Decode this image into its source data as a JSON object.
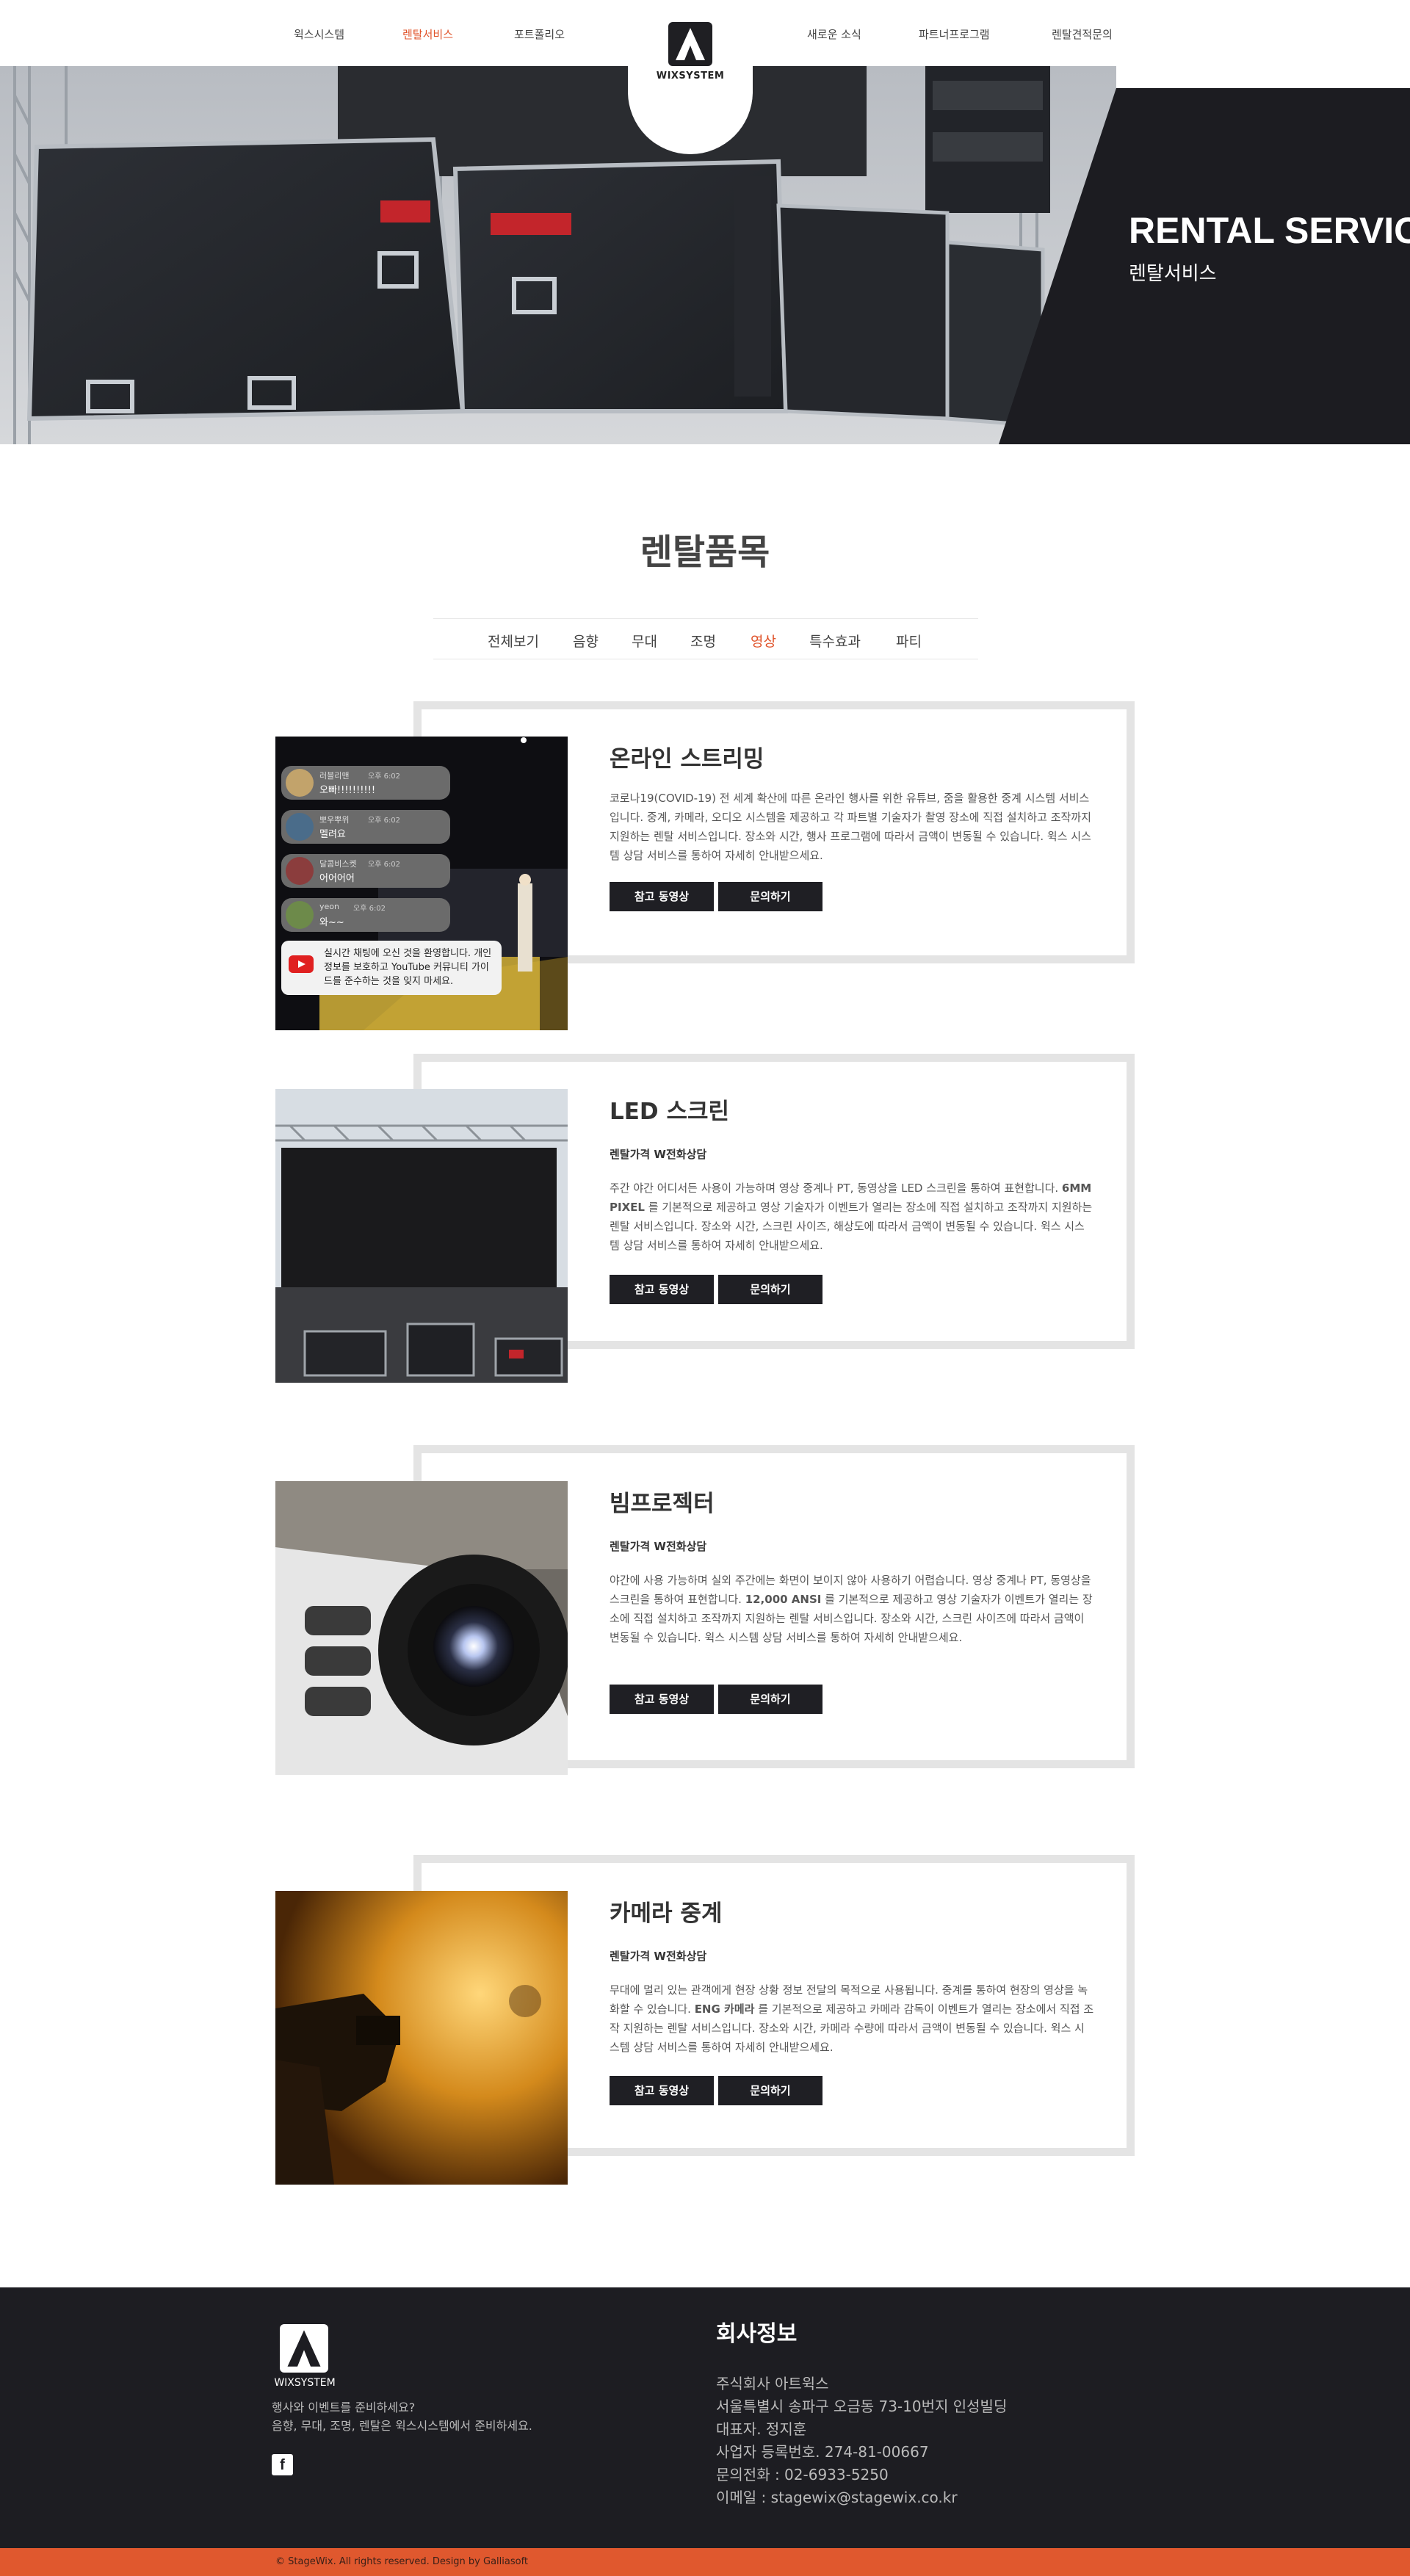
{
  "nav": {
    "items": [
      "윅스시스템",
      "렌탈서비스",
      "포트폴리오",
      "새로운 소식",
      "파트너프로그램",
      "렌탈견적문의"
    ],
    "active": "렌탈서비스",
    "logo_text": "WIXSYSTEM"
  },
  "hero": {
    "title": "RENTAL SERVICE",
    "subtitle": "렌탈서비스"
  },
  "section": {
    "title": "렌탈품목",
    "filters": [
      "전체보기",
      "음향",
      "무대",
      "조명",
      "영상",
      "특수효과",
      "파티"
    ],
    "active_filter": "영상"
  },
  "streaming_overlay": {
    "comments": [
      {
        "user": "러블리맨",
        "time": "오후 6:02",
        "text": "오빠!!!!!!!!!!"
      },
      {
        "user": "뽀우뿌위",
        "time": "오후 6:02",
        "text": "멜려요"
      },
      {
        "user": "달콤비스켓",
        "time": "오후 6:02",
        "text": "어어어어"
      },
      {
        "user": "yeon",
        "time": "오후 6:02",
        "text": "와~~"
      }
    ],
    "notice": "실시간 채팅에 오신 것을 환영합니다. 개인정보를 보호하고 YouTube 커뮤니티 가이드를 준수하는 것을 잊지 마세요."
  },
  "cards": [
    {
      "title": "온라인 스트리밍",
      "price": "",
      "desc_before": "코로나19(COVID-19) 전 세계 확산에 따른 온라인 행사를 위한 유튜브, 줌을 활용한 중계 시스템 서비스입니다. 중계, 카메라, 오디오 시스템을 제공하고 각 파트별 기술자가 촬영 장소에 직접 설치하고 조작까지 지원하는 렌탈 서비스입니다. 장소와 시간, 행사 프로그램에 따라서 금액이 변동될 수 있습니다. 윅스 시스템 상담 서비스를 통하여 자세히 안내받으세요.",
      "desc_bold": "",
      "desc_after": "",
      "btn_video": "참고 동영상",
      "btn_contact": "문의하기"
    },
    {
      "title": "LED 스크린",
      "price": "렌탈가격 W전화상담",
      "desc_before": "주간 야간 어디서든 사용이 가능하며 영상 중계나 PT, 동영상을 LED 스크린을 통하여 표현합니다. ",
      "desc_bold": "6MM PIXEL",
      "desc_after": " 를 기본적으로 제공하고 영상 기술자가 이벤트가 열리는 장소에 직접 설치하고 조작까지 지원하는 렌탈 서비스입니다. 장소와 시간, 스크린 사이즈, 해상도에 따라서 금액이 변동될 수 있습니다. 윅스 시스템 상담 서비스를 통하여 자세히 안내받으세요.",
      "btn_video": "참고 동영상",
      "btn_contact": "문의하기"
    },
    {
      "title": "빔프로젝터",
      "price": "렌탈가격 W전화상담",
      "desc_before": "야간에 사용 가능하며 실외 주간에는 화면이 보이지 않아 사용하기 어렵습니다. 영상 중계나 PT, 동영상을 스크린을 통하여 표현합니다. ",
      "desc_bold": "12,000 ANSI",
      "desc_after": " 를 기본적으로 제공하고 영상 기술자가 이벤트가 열리는 장소에 직접 설치하고 조작까지 지원하는 렌탈 서비스입니다. 장소와 시간, 스크린 사이즈에 따라서 금액이 변동될 수 있습니다. 윅스 시스템 상담 서비스를 통하여 자세히 안내받으세요.",
      "btn_video": "참고 동영상",
      "btn_contact": "문의하기"
    },
    {
      "title": "카메라 중계",
      "price": "렌탈가격 W전화상담",
      "desc_before": "무대에 멀리 있는 관객에게 현장 상황 정보 전달의 목적으로 사용됩니다. 중계를 통하여 현장의 영상을 녹화할 수 있습니다. ",
      "desc_bold": "ENG 카메라",
      "desc_after": " 를 기본적으로 제공하고 카메라 감독이 이벤트가 열리는 장소에서 직접 조작 지원하는 렌탈 서비스입니다. 장소와 시간, 카메라 수량에 따라서 금액이 변동될 수 있습니다. 윅스 시스템 상담 서비스를 통하여 자세히 안내받으세요.",
      "btn_video": "참고 동영상",
      "btn_contact": "문의하기"
    }
  ],
  "footer": {
    "logo_text": "WIXSYSTEM",
    "tagline_1": "행사와 이벤트를 준비하세요?",
    "tagline_2": "음향, 무대, 조명, 렌탈은 윅스시스템에서 준비하세요.",
    "facebook": "f",
    "heading": "회사정보",
    "company": "주식회사 아트윅스",
    "address": "서울특별시 송파구 오금동 73-10번지 인성빌딩",
    "ceo": "대표자. 정지훈",
    "biz_no": "사업자 등록번호. 274-81-00667",
    "phone": "문의전화 : 02-6933-5250",
    "email": "이메일 : stagewix@stagewix.co.kr",
    "copyright": "© StageWix. All rights reserved. Design by Galliasoft"
  },
  "colors": {
    "accent": "#e0532a",
    "dark": "#1d1d22",
    "frame": "#e4e4e4",
    "copyright_bar": "#e0582e"
  }
}
